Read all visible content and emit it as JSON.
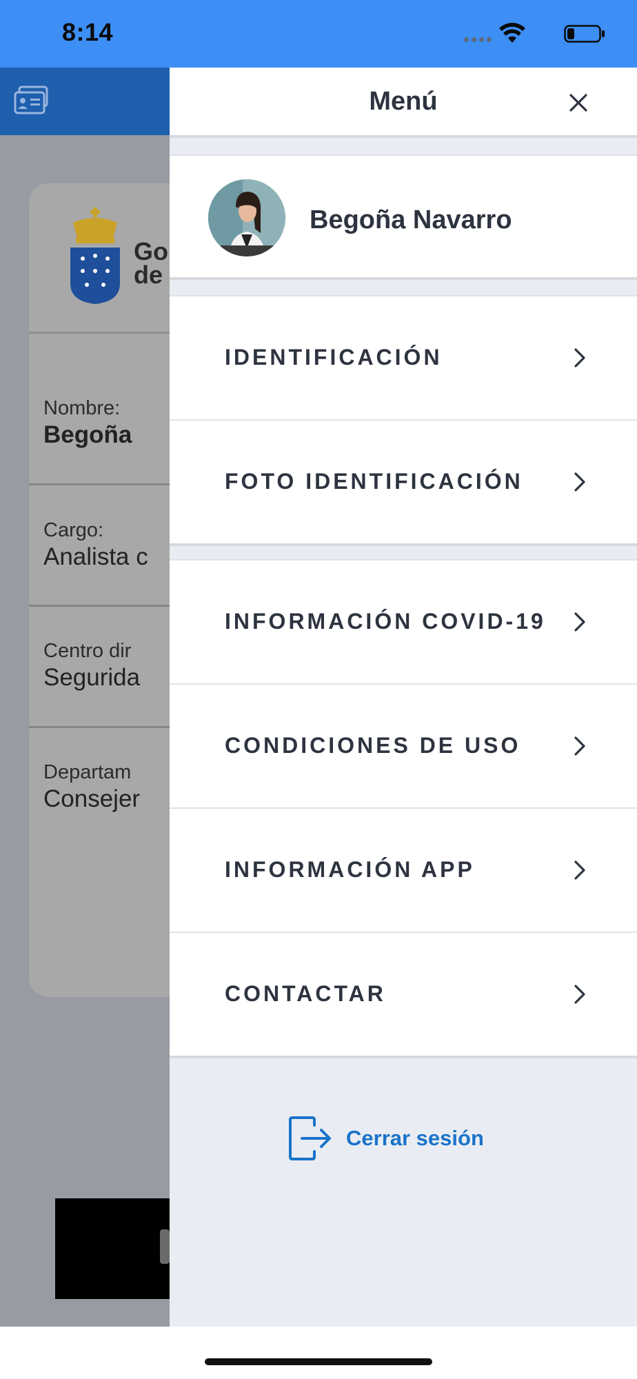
{
  "status_bar": {
    "time": "8:14",
    "icons": [
      "signal-icon",
      "wifi-icon",
      "battery-icon"
    ]
  },
  "background_screen": {
    "logo_text_line1": "Go",
    "logo_text_line2": "de",
    "fields": [
      {
        "label": "Nombre:",
        "value": "Begoña"
      },
      {
        "label": "Cargo:",
        "value": "Analista c"
      },
      {
        "label": "Centro dir",
        "value": "Segurida"
      },
      {
        "label": "Departam",
        "value": "Consejer"
      }
    ]
  },
  "menu": {
    "title": "Menú",
    "close_icon": "close-icon",
    "profile_name": "Begoña Navarro",
    "group1": [
      {
        "label": "IDENTIFICACIÓN"
      },
      {
        "label": "FOTO IDENTIFICACIÓN"
      }
    ],
    "group2": [
      {
        "label": "INFORMACIÓN COVID-19"
      },
      {
        "label": "CONDICIONES DE USO"
      },
      {
        "label": "INFORMACIÓN APP"
      },
      {
        "label": "CONTACTAR"
      }
    ],
    "logout_label": "Cerrar sesión"
  },
  "colors": {
    "status_bar": "#3d8ef5",
    "accent": "#1a73c9",
    "menu_text": "#2e3340",
    "drawer_bg": "#e9edf3"
  }
}
